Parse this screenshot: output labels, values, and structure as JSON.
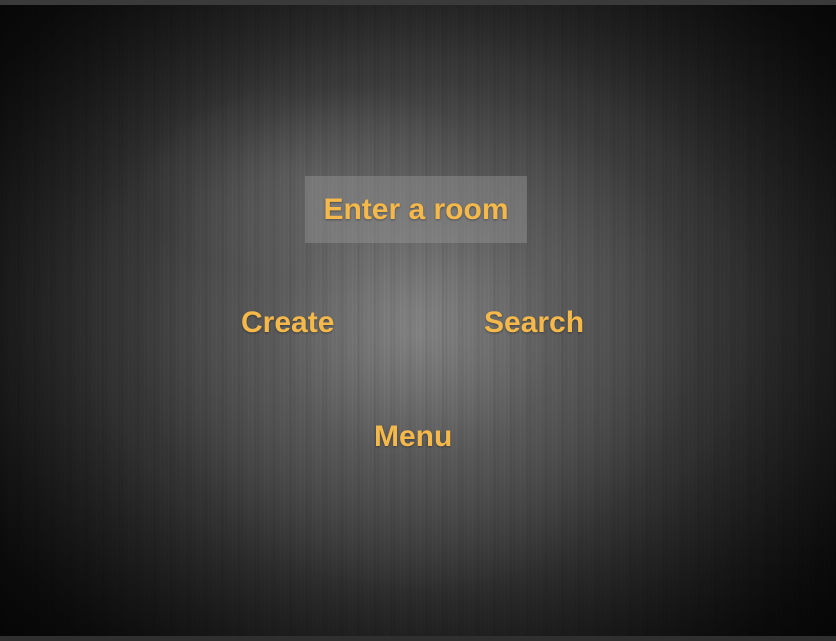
{
  "menu": {
    "enter_room_label": "Enter a room",
    "create_label": "Create",
    "search_label": "Search",
    "menu_label": "Menu"
  },
  "colors": {
    "accent_text": "#f5b84a",
    "highlight_background": "#969696"
  }
}
